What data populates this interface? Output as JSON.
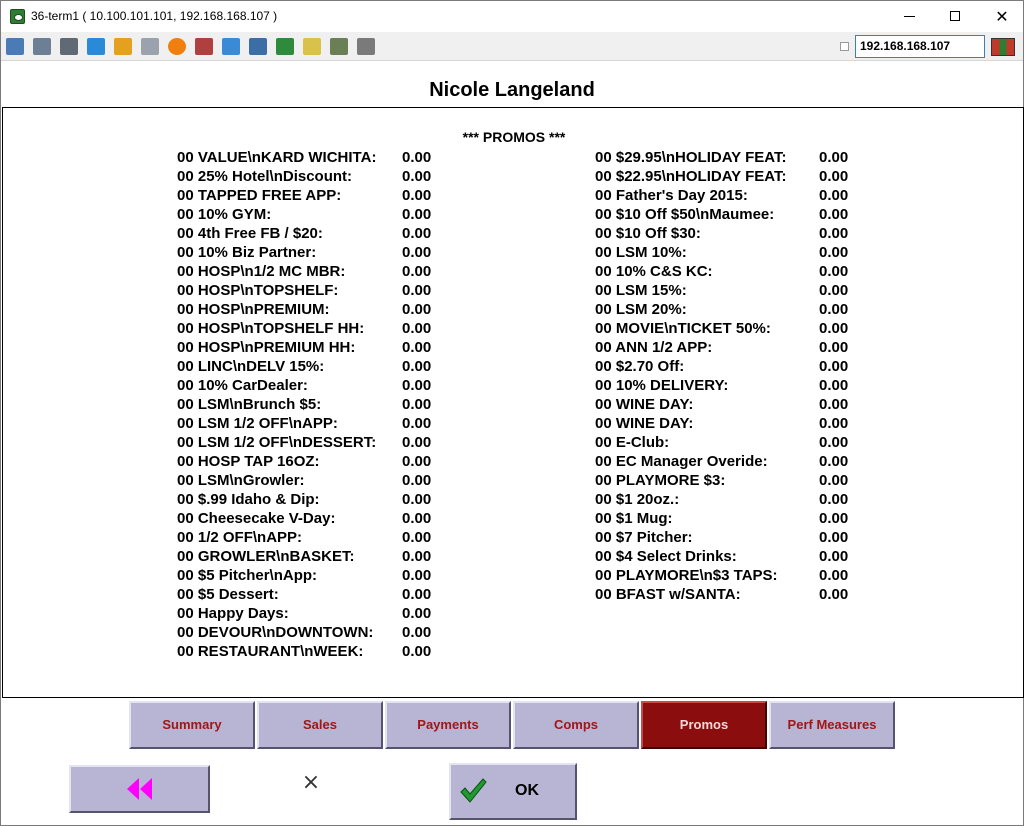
{
  "window": {
    "title": "36-term1 ( 10.100.101.101, 192.168.168.107 )",
    "minimize_glyph": "",
    "maximize_glyph": "",
    "close_glyph": "✕"
  },
  "toolbar": {
    "icons": [
      "monitor-icon",
      "windows-icon",
      "tools-icon",
      "refresh-icon",
      "windows-logo-icon",
      "keyboard-icon",
      "alert-icon",
      "network-icon",
      "fullscreen-icon",
      "display-icon",
      "transfer-icon",
      "note-icon",
      "map-icon",
      "screens-icon"
    ],
    "ip_address": "192.168.168.107",
    "flag_colors": [
      "#c0392b",
      "#2e7d32",
      "#c0392b"
    ]
  },
  "employee_name": "Nicole Langeland",
  "report": {
    "title": "*** PROMOS ***",
    "left_column": [
      {
        "label": "00 VALUE\\nKARD WICHITA:",
        "value": "0.00"
      },
      {
        "label": "00 25% Hotel\\nDiscount:",
        "value": "0.00"
      },
      {
        "label": "00 TAPPED FREE APP:",
        "value": "0.00"
      },
      {
        "label": "00 10% GYM:",
        "value": "0.00"
      },
      {
        "label": "00 4th Free FB / $20:",
        "value": "0.00"
      },
      {
        "label": "00 10% Biz Partner:",
        "value": "0.00"
      },
      {
        "label": "00 HOSP\\n1/2 MC MBR:",
        "value": "0.00"
      },
      {
        "label": "00 HOSP\\nTOPSHELF:",
        "value": "0.00"
      },
      {
        "label": "00 HOSP\\nPREMIUM:",
        "value": "0.00"
      },
      {
        "label": "00 HOSP\\nTOPSHELF HH:",
        "value": "0.00"
      },
      {
        "label": "00 HOSP\\nPREMIUM HH:",
        "value": "0.00"
      },
      {
        "label": "00 LINC\\nDELV 15%:",
        "value": "0.00"
      },
      {
        "label": "00 10% CarDealer:",
        "value": "0.00"
      },
      {
        "label": "00 LSM\\nBrunch $5:",
        "value": "0.00"
      },
      {
        "label": "00 LSM 1/2 OFF\\nAPP:",
        "value": "0.00"
      },
      {
        "label": "00 LSM 1/2 OFF\\nDESSERT:",
        "value": "0.00"
      },
      {
        "label": "00 HOSP TAP 16OZ:",
        "value": "0.00"
      },
      {
        "label": "00 LSM\\nGrowler:",
        "value": "0.00"
      },
      {
        "label": "00 $.99 Idaho & Dip:",
        "value": "0.00"
      },
      {
        "label": "00 Cheesecake V-Day:",
        "value": "0.00"
      },
      {
        "label": "00 1/2 OFF\\nAPP:",
        "value": "0.00"
      },
      {
        "label": "00 GROWLER\\nBASKET:",
        "value": "0.00"
      },
      {
        "label": "00 $5 Pitcher\\nApp:",
        "value": "0.00"
      },
      {
        "label": "00 $5 Dessert:",
        "value": "0.00"
      },
      {
        "label": "00 Happy Days:",
        "value": "0.00"
      },
      {
        "label": "00 DEVOUR\\nDOWNTOWN:",
        "value": "0.00"
      },
      {
        "label": "00 RESTAURANT\\nWEEK:",
        "value": "0.00"
      }
    ],
    "right_column": [
      {
        "label": "00 $29.95\\nHOLIDAY FEAT:",
        "value": "0.00"
      },
      {
        "label": "00 $22.95\\nHOLIDAY FEAT:",
        "value": "0.00"
      },
      {
        "label": "00 Father's Day 2015:",
        "value": "0.00"
      },
      {
        "label": "00 $10 Off $50\\nMaumee:",
        "value": "0.00"
      },
      {
        "label": "00 $10 Off $30:",
        "value": "0.00"
      },
      {
        "label": "00 LSM 10%:",
        "value": "0.00"
      },
      {
        "label": "00 10% C&S KC:",
        "value": "0.00"
      },
      {
        "label": "00 LSM 15%:",
        "value": "0.00"
      },
      {
        "label": "00 LSM 20%:",
        "value": "0.00"
      },
      {
        "label": "00 MOVIE\\nTICKET 50%:",
        "value": "0.00"
      },
      {
        "label": "00 ANN 1/2 APP:",
        "value": "0.00"
      },
      {
        "label": "00 $2.70 Off:",
        "value": "0.00"
      },
      {
        "label": "00 10% DELIVERY:",
        "value": "0.00"
      },
      {
        "label": "00 WINE DAY:",
        "value": "0.00"
      },
      {
        "label": "00 WINE DAY:",
        "value": "0.00"
      },
      {
        "label": "00 E-Club:",
        "value": "0.00"
      },
      {
        "label": "00 EC Manager Overide:",
        "value": "0.00"
      },
      {
        "label": "00 PLAYMORE $3:",
        "value": "0.00"
      },
      {
        "label": "00 $1 20oz.:",
        "value": "0.00"
      },
      {
        "label": "00 $1 Mug:",
        "value": "0.00"
      },
      {
        "label": "00 $7 Pitcher:",
        "value": "0.00"
      },
      {
        "label": "00 $4 Select Drinks:",
        "value": "0.00"
      },
      {
        "label": "00 PLAYMORE\\n$3 TAPS:",
        "value": "0.00"
      },
      {
        "label": "00 BFAST w/SANTA:",
        "value": "0.00"
      }
    ]
  },
  "tabs": [
    {
      "label": "Summary",
      "active": false
    },
    {
      "label": "Sales",
      "active": false
    },
    {
      "label": "Payments",
      "active": false
    },
    {
      "label": "Comps",
      "active": false
    },
    {
      "label": "Promos",
      "active": true
    },
    {
      "label": "Perf Measures",
      "active": false
    }
  ],
  "buttons": {
    "back_icon": "double-left-arrow-icon",
    "back_color": "#ff00ff",
    "close_glyph": "×",
    "ok_label": "OK",
    "ok_check_color": "#1f9a2e"
  },
  "colors": {
    "button_face": "#b7b5d3",
    "tab_text": "#a11616",
    "active_tab": "#8b0d0d"
  }
}
